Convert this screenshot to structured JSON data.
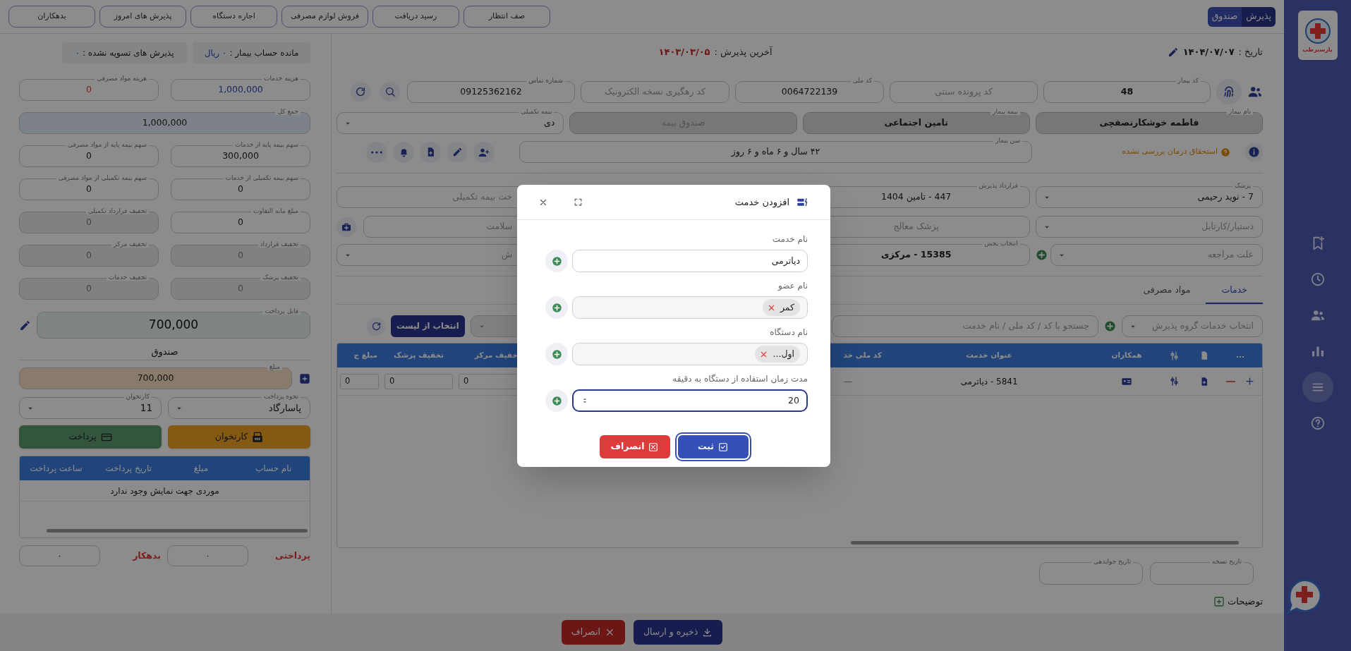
{
  "sidebar": {
    "logo_text": "پارسیزطب",
    "items": [
      {
        "kind": "bookmark",
        "selected": false
      },
      {
        "kind": "clock",
        "selected": false
      },
      {
        "kind": "users",
        "selected": false
      },
      {
        "kind": "chart",
        "selected": false
      },
      {
        "kind": "menu",
        "selected": true
      },
      {
        "kind": "help",
        "selected": false
      }
    ]
  },
  "top_bar": {
    "mode_tabs": [
      {
        "label": "پذیرش",
        "selected": true
      },
      {
        "label": "صندوق",
        "selected": false
      }
    ],
    "buttons": [
      "صف انتظار",
      "رسید دریافت",
      "فروش لوازم مصرفی",
      "اجاره دستگاه",
      "پذیرش های امروز",
      "بدهکاران"
    ]
  },
  "header": {
    "date_label": "تاریخ :",
    "date": "۱۴۰۴/۰۷/۰۷",
    "last_admission_label": "آخرین پذیرش :",
    "last_admission": "۱۴۰۳/۰۳/۰۵"
  },
  "patient": {
    "row1": [
      {
        "kind": "text",
        "label": "کد بیمار",
        "value": "48"
      },
      {
        "kind": "text",
        "placeholder": "کد پرونده سنتی"
      },
      {
        "kind": "text",
        "label": "کد ملی",
        "value": "0064722139"
      },
      {
        "kind": "text",
        "placeholder": "کد رهگیری نسخه الکترونیک"
      },
      {
        "kind": "text",
        "label": "شماره تماس",
        "value": "09125362162"
      }
    ],
    "row2": [
      {
        "kind": "text",
        "label": "نام بیمار",
        "value": "فاطمه خوشکارنصفچی",
        "readonly": true
      },
      {
        "kind": "text",
        "label": "بیمه بیمار",
        "value": "تامین اجتماعی",
        "readonly": true
      },
      {
        "kind": "text",
        "placeholder": "صندوق بیمه",
        "readonly": true
      },
      {
        "kind": "select",
        "label": "بیمه تکمیلی",
        "value": "دی",
        "readonly": false
      }
    ],
    "eligibility": "استحقاق درمان بررسی نشده",
    "age": {
      "kind": "text",
      "label": "سن بیمار",
      "value": "۴۲ سال و ۶ ماه و ۶ روز"
    }
  },
  "admission": [
    [
      {
        "kind": "select",
        "label": "پزشک",
        "value": "7 - نوید رحیمی"
      },
      {
        "kind": "text",
        "label": "قرارداد پذیرش",
        "value": "447 - تامین 1404"
      },
      {
        "kind": "text",
        "placeholder": "خت بیمه تکمیلی"
      }
    ],
    [
      {
        "kind": "select",
        "placeholder": "دستیار/کارتابل"
      },
      {
        "kind": "text",
        "placeholder": "پزشک معالج"
      },
      {
        "kind": "text",
        "placeholder": "سلامت"
      }
    ],
    [
      {
        "kind": "select",
        "placeholder": "علت مراجعه"
      },
      {
        "kind": "text",
        "label": "انتخاب بخش",
        "value": "15385 - مرکزی"
      },
      {
        "kind": "select",
        "placeholder": "ش"
      }
    ]
  ],
  "tabs": [
    {
      "label": "خدمات",
      "selected": true
    },
    {
      "label": "مواد مصرفی",
      "selected": false
    }
  ],
  "services": {
    "group_select": "انتخاب خدمات گروه پذیرش",
    "search_placeholder": "جستجو با کد / کد ملی / نام خدمت",
    "pick_button": "انتخاب از لیست",
    "columns": [
      {
        "kind": "text",
        "label": "..."
      },
      {
        "kind": "icon"
      },
      {
        "kind": "icon"
      },
      {
        "kind": "text",
        "label": "همکاران"
      },
      {
        "kind": "text",
        "label": "عنوان خدمت"
      },
      {
        "kind": "text",
        "label": "کد ملی خد"
      },
      {
        "kind": "text",
        "label": "خفیف مرکز"
      },
      {
        "kind": "text",
        "label": "تخفیف پزشک"
      },
      {
        "kind": "text",
        "label": "مبلغ ج"
      }
    ],
    "rows": [
      {
        "title": "5841 - دیاترمی",
        "national_code": "—",
        "values": [
          "0",
          "0",
          "0"
        ]
      }
    ]
  },
  "dates": [
    {
      "label": "تاریخ نسخه"
    },
    {
      "label": "تاریخ جوابدهی"
    }
  ],
  "notes_label": "توضیحات",
  "footer_buttons": [
    {
      "kind": "save",
      "label": "ذخیره و ارسال"
    },
    {
      "kind": "cancel",
      "label": "انصراف"
    }
  ],
  "account": {
    "balance_label": "مانده حساب بیمار :",
    "balance": "۰ ریال",
    "unsettled_label": "پذیرش های تسویه نشده :",
    "unsettled": "۰"
  },
  "summary": [
    {
      "kind": "service",
      "label": "هزینه خدمات",
      "value": "1,000,000"
    },
    {
      "kind": "material",
      "label": "هزینه مواد مصرفی",
      "value": "0"
    },
    {
      "kind": "total",
      "label": "جمع کل",
      "value": "1,000,000"
    },
    {
      "kind": "plain",
      "label": "سهم بیمه پایه از خدمات",
      "value": "300,000"
    },
    {
      "kind": "plain",
      "label": "سهم بیمه پایه از مواد مصرفی",
      "value": "0"
    },
    {
      "kind": "plain",
      "label": "سهم بیمه تکمیلی از خدمات",
      "value": "0"
    },
    {
      "kind": "plain",
      "label": "سهم بیمه تکمیلی از مواد مصرفی",
      "value": "0"
    },
    {
      "kind": "plain",
      "label": "مبلغ مابه التفاوت",
      "value": "0"
    },
    {
      "kind": "discount",
      "label": "تخفیف قرارداد تکمیلی",
      "value": "0"
    },
    {
      "kind": "discount",
      "label": "تخفیف قرارداد",
      "value": "0"
    },
    {
      "kind": "discount",
      "label": "تخفیف مرکز",
      "value": "0"
    },
    {
      "kind": "discount",
      "label": "تخفیف پزشک",
      "value": "0"
    },
    {
      "kind": "discount",
      "label": "تخفیف خدمات",
      "value": "0"
    }
  ],
  "payable": {
    "label": "قابل پرداخت",
    "value": "700,000"
  },
  "cashbox": {
    "title": "صندوق",
    "amount": {
      "label": "مبلغ",
      "value": "700,000"
    },
    "selects": [
      {
        "label": "نحوه پرداخت",
        "value": "پاسارگاد"
      },
      {
        "label": "کارتخوان",
        "value": "11"
      }
    ],
    "buttons": [
      {
        "kind": "pos",
        "label": "کارتخوان"
      },
      {
        "kind": "pay",
        "label": "پرداخت"
      }
    ],
    "columns": [
      "نام حساب",
      "مبلغ",
      "تاریخ پرداخت",
      "ساعت پرداخت"
    ],
    "empty": "موردی جهت نمایش وجود ندارد",
    "totals": [
      {
        "kind": "paid",
        "label": "پرداختی",
        "value": "۰"
      },
      {
        "kind": "debt",
        "label": "بدهکار",
        "value": "۰"
      }
    ]
  },
  "modal": {
    "title": "افزودن خدمت",
    "fields": [
      {
        "kind": "text",
        "label": "نام خدمت",
        "value": "دیاترمی",
        "focused": false
      },
      {
        "kind": "chips",
        "label": "نام عضو",
        "chips": [
          "کمر"
        ],
        "focused": false
      },
      {
        "kind": "chips",
        "label": "نام دستگاه",
        "chips": [
          "اول..."
        ],
        "focused": false
      },
      {
        "kind": "number",
        "label": "مدت زمان استفاده از دستگاه به دقیقه",
        "value": "20",
        "focused": true
      }
    ],
    "buttons": [
      {
        "kind": "submit",
        "label": "ثبت"
      },
      {
        "kind": "cancel",
        "label": "انصراف"
      }
    ]
  }
}
